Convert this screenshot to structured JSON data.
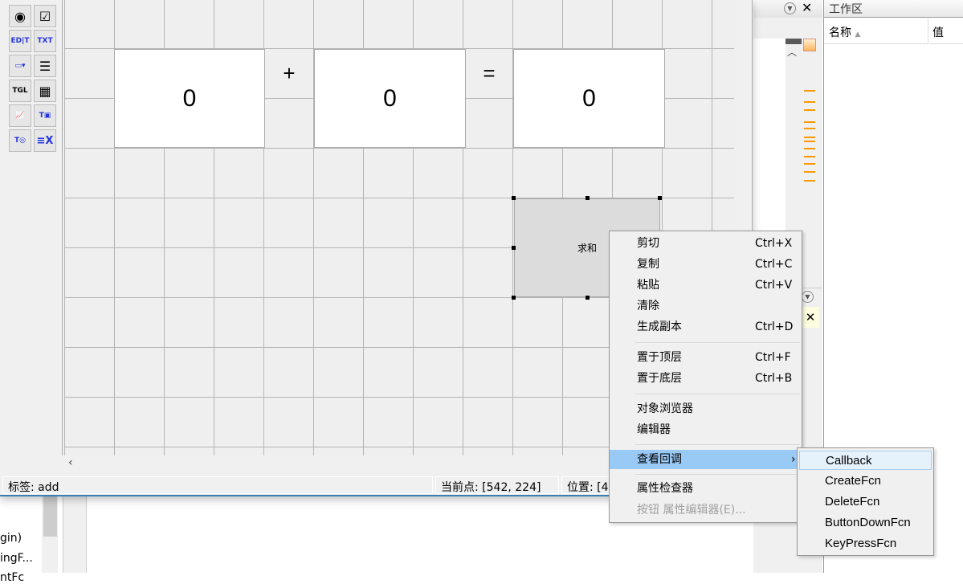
{
  "palette": {
    "tools": [
      "radio-button",
      "checkbox",
      "edit-text",
      "static-text",
      "popup-menu",
      "listbox",
      "toggle-button",
      "table",
      "axes",
      "panel",
      "button-group",
      "activex"
    ]
  },
  "canvas": {
    "edit1": "0",
    "plus": "+",
    "edit2": "0",
    "equals": "=",
    "edit3": "0",
    "button_label": "求和"
  },
  "status": {
    "tag": "标签: add",
    "current_point": "当前点:  [542, 224]",
    "position": "位置: [4"
  },
  "below": {
    "lines": [
      "gin)",
      "ingF...",
      "ntFc"
    ]
  },
  "workspace": {
    "title": "工作区",
    "col_name": "名称",
    "col_value": "值"
  },
  "context_menu": {
    "items": [
      {
        "label": "剪切",
        "shortcut": "Ctrl+X"
      },
      {
        "label": "复制",
        "shortcut": "Ctrl+C"
      },
      {
        "label": "粘贴",
        "shortcut": "Ctrl+V"
      },
      {
        "label": "清除",
        "shortcut": ""
      },
      {
        "label": "生成副本",
        "shortcut": "Ctrl+D"
      },
      {
        "label": "置于顶层",
        "shortcut": "Ctrl+F"
      },
      {
        "label": "置于底层",
        "shortcut": "Ctrl+B"
      },
      {
        "label": "对象浏览器",
        "shortcut": ""
      },
      {
        "label": "编辑器",
        "shortcut": ""
      },
      {
        "label": "查看回调",
        "shortcut": ""
      },
      {
        "label": "属性检查器",
        "shortcut": ""
      },
      {
        "label": "按钮 属性编辑器(E)...",
        "shortcut": "",
        "disabled": true
      }
    ],
    "highlighted": "查看回调",
    "submenu": [
      "Callback",
      "CreateFcn",
      "DeleteFcn",
      "ButtonDownFcn",
      "KeyPressFcn"
    ]
  },
  "colors": {
    "menu_highlight": "#99c9f5",
    "accent_orange": "#ff9900"
  }
}
